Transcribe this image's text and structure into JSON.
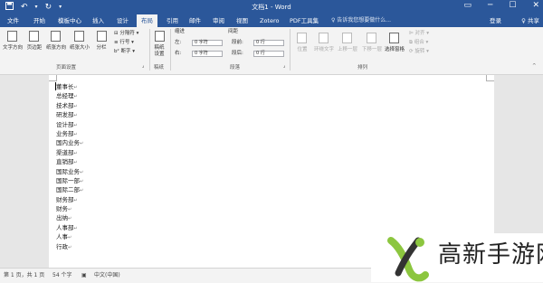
{
  "quick_access": {
    "save_icon": "save-icon",
    "undo": "↶",
    "undo_drop": "▾",
    "redo": "↻",
    "customize": "▾"
  },
  "window": {
    "title": "文档1 - Word",
    "controls": [
      "▭",
      "─",
      "☐",
      "✕"
    ]
  },
  "tabs": [
    {
      "label": "文件"
    },
    {
      "label": "开始"
    },
    {
      "label": "模板中心"
    },
    {
      "label": "插入"
    },
    {
      "label": "设计"
    },
    {
      "label": "布局",
      "active": true
    },
    {
      "label": "引用"
    },
    {
      "label": "邮件"
    },
    {
      "label": "审阅"
    },
    {
      "label": "视图"
    },
    {
      "label": "Zotero"
    },
    {
      "label": "PDF工具集"
    }
  ],
  "tell_me": "♀ 告诉我您想要做什么...",
  "account": {
    "login": "登录",
    "share": "♀ 共享"
  },
  "ribbon": {
    "page_setup": {
      "group": "页面设置",
      "text_direction": "文字方向",
      "margins": "页边距",
      "orientation": "纸张方向",
      "size": "纸张大小",
      "columns": "分栏",
      "breaks": "分隔符",
      "line_numbers": "行号",
      "hyphenation": "断字"
    },
    "draft": {
      "group": "稿纸",
      "label1": "稿纸",
      "label2": "设置"
    },
    "paragraph": {
      "group": "段落",
      "indent": "缩进",
      "spacing": "间距",
      "left_label": "左:",
      "right_label": "右:",
      "before_label": "段前:",
      "after_label": "段后:",
      "left_value": "0 字符",
      "right_value": "0 字符",
      "before_value": "0 行",
      "after_value": "0 行"
    },
    "arrange": {
      "group": "排列",
      "position": "位置",
      "wrap_text": "环绕文字",
      "bring_forward": "上移一层",
      "send_backward": "下移一层",
      "selection_pane": "选择窗格",
      "align": "对齐",
      "group_btn": "组合",
      "rotate": "旋转"
    }
  },
  "document": {
    "lines": [
      "董事长",
      "总经理",
      "技术部",
      "研发部",
      "设计部",
      "业务部",
      "国内业务",
      "渠道部",
      "直销部",
      "国际业务",
      "国际一部",
      "国际二部",
      "财务部",
      "财务",
      "出纳",
      "人事部",
      "人事",
      "行政"
    ],
    "paragraph_mark": "↵"
  },
  "status": {
    "page": "第 1 页，共 1 页",
    "words": "54 个字",
    "language": "中文(中国)"
  },
  "watermark": {
    "text": "高新手游网"
  },
  "colors": {
    "accent": "#2b579a",
    "ribbon_bg": "#f3f3f3",
    "canvas_bg": "#e6e6e6",
    "logo_green": "#8cc63f"
  }
}
